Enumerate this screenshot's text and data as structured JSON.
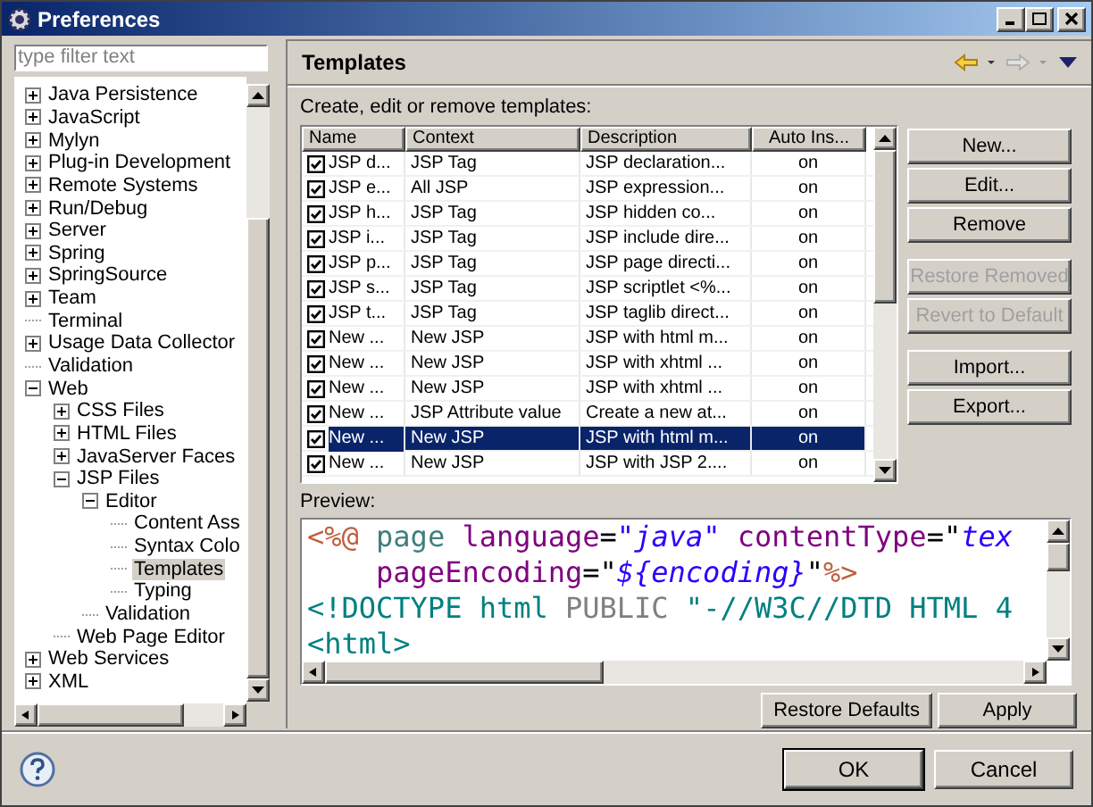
{
  "window": {
    "title": "Preferences"
  },
  "filter": {
    "placeholder": "type filter text"
  },
  "tree": [
    {
      "label": "Java Persistence",
      "kind": "folder",
      "expanded": false,
      "selected": false
    },
    {
      "label": "JavaScript",
      "kind": "folder",
      "expanded": false,
      "selected": false
    },
    {
      "label": "Mylyn",
      "kind": "folder",
      "expanded": false,
      "selected": false
    },
    {
      "label": "Plug-in Development",
      "kind": "folder",
      "expanded": false,
      "selected": false
    },
    {
      "label": "Remote Systems",
      "kind": "folder",
      "expanded": false,
      "selected": false
    },
    {
      "label": "Run/Debug",
      "kind": "folder",
      "expanded": false,
      "selected": false
    },
    {
      "label": "Server",
      "kind": "folder",
      "expanded": false,
      "selected": false
    },
    {
      "label": "Spring",
      "kind": "folder",
      "expanded": false,
      "selected": false
    },
    {
      "label": "SpringSource",
      "kind": "folder",
      "expanded": false,
      "selected": false
    },
    {
      "label": "Team",
      "kind": "folder",
      "expanded": false,
      "selected": false
    },
    {
      "label": "Terminal",
      "kind": "leaf",
      "selected": false
    },
    {
      "label": "Usage Data Collector",
      "kind": "folder",
      "expanded": false,
      "selected": false
    },
    {
      "label": "Validation",
      "kind": "leaf",
      "selected": false
    },
    {
      "label": "Web",
      "kind": "folder",
      "expanded": true,
      "selected": false,
      "children": [
        {
          "label": "CSS Files",
          "kind": "folder",
          "expanded": false,
          "selected": false
        },
        {
          "label": "HTML Files",
          "kind": "folder",
          "expanded": false,
          "selected": false
        },
        {
          "label": "JavaServer Faces",
          "kind": "folder",
          "expanded": false,
          "selected": false
        },
        {
          "label": "JSP Files",
          "kind": "folder",
          "expanded": true,
          "selected": false,
          "children": [
            {
              "label": "Editor",
              "kind": "folder",
              "expanded": true,
              "selected": false,
              "children": [
                {
                  "label": "Content Ass",
                  "kind": "leaf",
                  "selected": false
                },
                {
                  "label": "Syntax Colo",
                  "kind": "leaf",
                  "selected": false
                },
                {
                  "label": "Templates",
                  "kind": "leaf",
                  "selected": true
                },
                {
                  "label": "Typing",
                  "kind": "leaf",
                  "selected": false
                }
              ]
            },
            {
              "label": "Validation",
              "kind": "leaf",
              "selected": false
            }
          ]
        },
        {
          "label": "Web Page Editor",
          "kind": "leaf",
          "selected": false
        }
      ]
    },
    {
      "label": "Web Services",
      "kind": "folder",
      "expanded": false,
      "selected": false
    },
    {
      "label": "XML",
      "kind": "folder",
      "expanded": false,
      "selected": false
    }
  ],
  "page": {
    "title": "Templates",
    "description": "Create, edit or remove templates:"
  },
  "table": {
    "columns": [
      "Name",
      "Context",
      "Description",
      "Auto Ins..."
    ],
    "rows": [
      {
        "name": "JSP d...",
        "context": "JSP Tag",
        "description": "JSP declaration...",
        "auto_insert": "on",
        "checked": true,
        "selected": false
      },
      {
        "name": "JSP e...",
        "context": "All JSP",
        "description": "JSP expression...",
        "auto_insert": "on",
        "checked": true,
        "selected": false
      },
      {
        "name": "JSP h...",
        "context": "JSP Tag",
        "description": "JSP hidden co...",
        "auto_insert": "on",
        "checked": true,
        "selected": false
      },
      {
        "name": "JSP i...",
        "context": "JSP Tag",
        "description": "JSP include dire...",
        "auto_insert": "on",
        "checked": true,
        "selected": false
      },
      {
        "name": "JSP p...",
        "context": "JSP Tag",
        "description": "JSP page directi...",
        "auto_insert": "on",
        "checked": true,
        "selected": false
      },
      {
        "name": "JSP s...",
        "context": "JSP Tag",
        "description": "JSP scriptlet <%...",
        "auto_insert": "on",
        "checked": true,
        "selected": false
      },
      {
        "name": "JSP t...",
        "context": "JSP Tag",
        "description": "JSP taglib direct...",
        "auto_insert": "on",
        "checked": true,
        "selected": false
      },
      {
        "name": "New ...",
        "context": "New JSP",
        "description": "JSP with html m...",
        "auto_insert": "on",
        "checked": true,
        "selected": false
      },
      {
        "name": "New ...",
        "context": "New JSP",
        "description": "JSP with xhtml ...",
        "auto_insert": "on",
        "checked": true,
        "selected": false
      },
      {
        "name": "New ...",
        "context": "New JSP",
        "description": "JSP with xhtml ...",
        "auto_insert": "on",
        "checked": true,
        "selected": false
      },
      {
        "name": "New ...",
        "context": "JSP Attribute value",
        "description": "Create a new at...",
        "auto_insert": "on",
        "checked": true,
        "selected": false
      },
      {
        "name": "New ...",
        "context": "New JSP",
        "description": "JSP with html m...",
        "auto_insert": "on",
        "checked": true,
        "selected": true
      },
      {
        "name": "New ...",
        "context": "New JSP",
        "description": "JSP with JSP 2....",
        "auto_insert": "on",
        "checked": true,
        "selected": false
      }
    ]
  },
  "side_buttons": [
    {
      "label": "New...",
      "disabled": false,
      "kind": "button"
    },
    {
      "label": "Edit...",
      "disabled": false,
      "kind": "button"
    },
    {
      "label": "Remove",
      "disabled": false,
      "kind": "button"
    },
    {
      "label": "Restore Removed",
      "disabled": true,
      "kind": "gap"
    },
    {
      "label": "Revert to Default",
      "disabled": true,
      "kind": "button"
    },
    {
      "label": "Import...",
      "disabled": false,
      "kind": "gap"
    },
    {
      "label": "Export...",
      "disabled": false,
      "kind": "button"
    }
  ],
  "preview": {
    "label": "Preview:",
    "lines": [
      [
        {
          "text": "<%@",
          "kind": "delimiter"
        },
        {
          "text": " page",
          "kind": "directive"
        },
        {
          "text": " language",
          "kind": "attribute"
        },
        {
          "text": "=",
          "kind": "plain"
        },
        {
          "text": "\"java\"",
          "kind": "value"
        },
        {
          "text": " contentType",
          "kind": "attribute"
        },
        {
          "text": "=\"",
          "kind": "plain"
        },
        {
          "text": "tex",
          "kind": "value"
        }
      ],
      [
        {
          "text": "    pageEncoding",
          "kind": "attribute"
        },
        {
          "text": "=\"",
          "kind": "plain"
        },
        {
          "text": "${encoding}",
          "kind": "value"
        },
        {
          "text": "\"",
          "kind": "plain"
        },
        {
          "text": "%>",
          "kind": "delimiter"
        }
      ],
      [
        {
          "text": "<!DOCTYPE html",
          "kind": "tag"
        },
        {
          "text": " PUBLIC",
          "kind": "keyword"
        },
        {
          "text": " \"-//W3C//DTD HTML 4",
          "kind": "tag"
        }
      ],
      [
        {
          "text": "<html>",
          "kind": "tag"
        }
      ]
    ]
  },
  "page_buttons": [
    "Restore Defaults",
    "Apply"
  ],
  "dialog_buttons": [
    {
      "label": "OK",
      "default": true
    },
    {
      "label": "Cancel",
      "default": false
    }
  ]
}
